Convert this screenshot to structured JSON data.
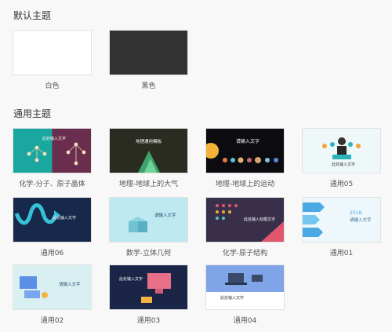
{
  "default_section": {
    "title": "默认主题",
    "themes": [
      {
        "label": "白色"
      },
      {
        "label": "黑色"
      }
    ]
  },
  "general_section": {
    "title": "通用主题",
    "themes": [
      {
        "label": "化学-分子、原子晶体",
        "text": "此处输入文字"
      },
      {
        "label": "地理-地球上的大气",
        "text": "地理通用模板"
      },
      {
        "label": "地理-地球上的运动",
        "text": "请输入文字"
      },
      {
        "label": "通用05",
        "text": "此处输入文字"
      },
      {
        "label": "通用06",
        "text": "此处输入文字"
      },
      {
        "label": "数学-立体几何",
        "text": "请输入文字"
      },
      {
        "label": "化学-原子结构",
        "text": "此处输入标题文字"
      },
      {
        "label": "通用01",
        "year": "2018",
        "text": "请输入文字"
      },
      {
        "label": "通用02",
        "text": "请输入文字"
      },
      {
        "label": "通用03",
        "text": "此处输入文字"
      },
      {
        "label": "通用04",
        "text": "此处输入文字"
      }
    ]
  }
}
